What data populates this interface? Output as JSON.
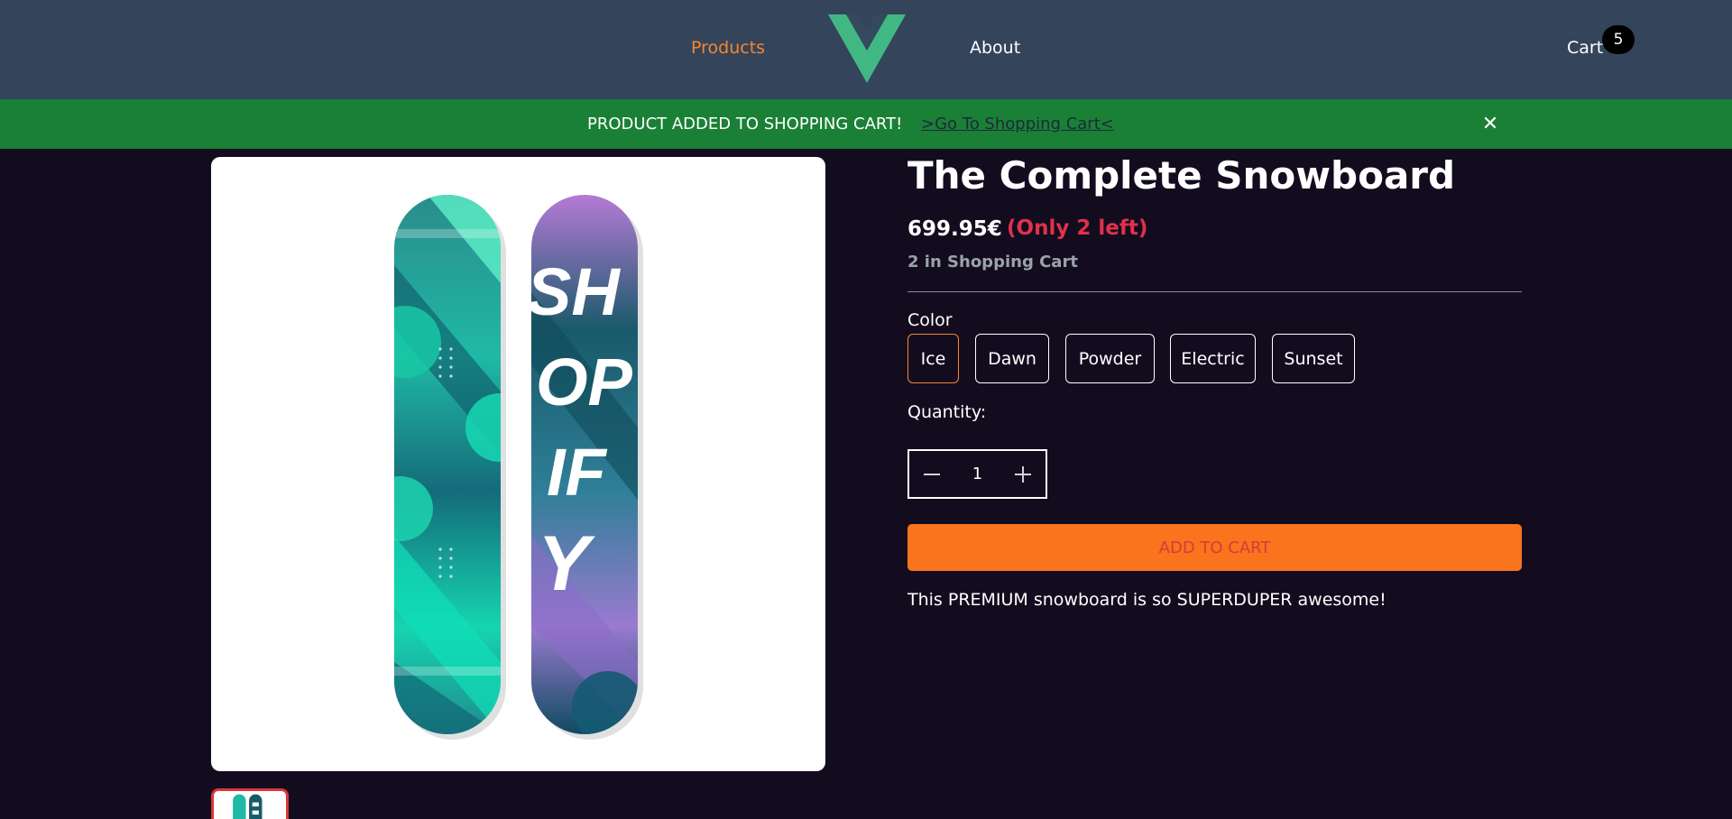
{
  "nav": {
    "products": "Products",
    "about": "About",
    "cart": "Cart",
    "cart_count": "5",
    "logo_icon": "vue-logo-icon",
    "active_color": "#f5862f"
  },
  "banner": {
    "message": "PRODUCT ADDED TO SHOPPING CART!",
    "link": ">Go To Shopping Cart<",
    "close": "✕",
    "background": "#1a8036"
  },
  "product": {
    "title": "The Complete Snowboard",
    "price": "699.95€",
    "stock": "(Only 2 left)",
    "in_cart": "2 in Shopping Cart",
    "color_label": "Color",
    "colors": [
      "Ice",
      "Dawn",
      "Powder",
      "Electric",
      "Sunset"
    ],
    "selected_color": "Ice",
    "quantity_label": "Quantity:",
    "quantity": "1",
    "add_to_cart": "ADD TO CART",
    "description": "This PREMIUM snowboard is so SUPERDUPER awesome!",
    "image_text": "SHOPIFY"
  }
}
